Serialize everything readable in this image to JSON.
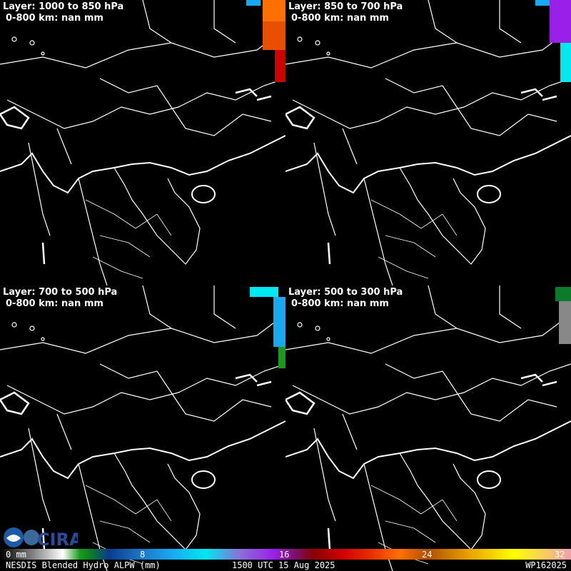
{
  "panels": [
    {
      "layer": "Layer: 1000 to 850 hPa",
      "stat": "0-800 km: nan mm"
    },
    {
      "layer": "Layer: 850 to 700 hPa",
      "stat": "0-800 km: nan mm"
    },
    {
      "layer": "Layer: 700 to 500 hPa",
      "stat": "0-800 km: nan mm"
    },
    {
      "layer": "Layer: 500 to 300 hPa",
      "stat": "0-800 km: nan mm"
    }
  ],
  "colorbar": {
    "ticks": [
      "0 mm",
      "8",
      "16",
      "24",
      "32"
    ],
    "range": [
      0,
      32
    ],
    "units": "mm"
  },
  "footer": {
    "product": "NESDIS Blended Hydro ALPW (mm)",
    "time": "1500 UTC 15 Aug 2025",
    "storm": "WP162025"
  },
  "logos": {
    "noaa": "NOAA",
    "cira": "CIRA"
  }
}
